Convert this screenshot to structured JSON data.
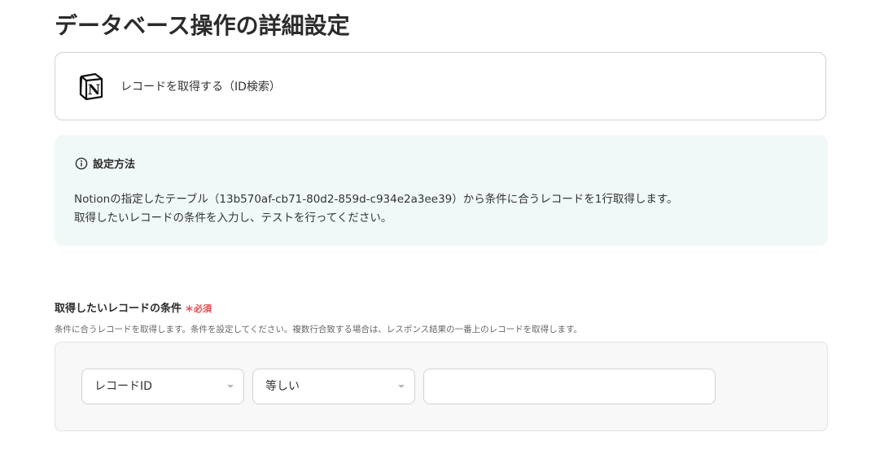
{
  "page": {
    "title": "データベース操作の詳細設定"
  },
  "action": {
    "icon": "notion-logo",
    "label": "レコードを取得する（ID検索）"
  },
  "info": {
    "heading": "設定方法",
    "icon": "info-circle-icon",
    "line1": "Notionの指定したテーブル（13b570af-cb71-80d2-859d-c934e2a3ee39）から条件に合うレコードを1行取得します。",
    "line2": "取得したいレコードの条件を入力し、テストを行ってください。",
    "background_color": "#f1f9f8"
  },
  "condition_field": {
    "label": "取得したいレコードの条件",
    "required_mark": "＊",
    "required_text": "必須",
    "required_color": "#e5484d",
    "help": "条件に合うレコードを取得します。条件を設定してください。複数行合致する場合は、レスポンス結果の一番上のレコードを取得します。",
    "field_select": {
      "value": "レコードID"
    },
    "operator_select": {
      "value": "等しい"
    },
    "value_input": {
      "value": "",
      "placeholder": ""
    }
  }
}
